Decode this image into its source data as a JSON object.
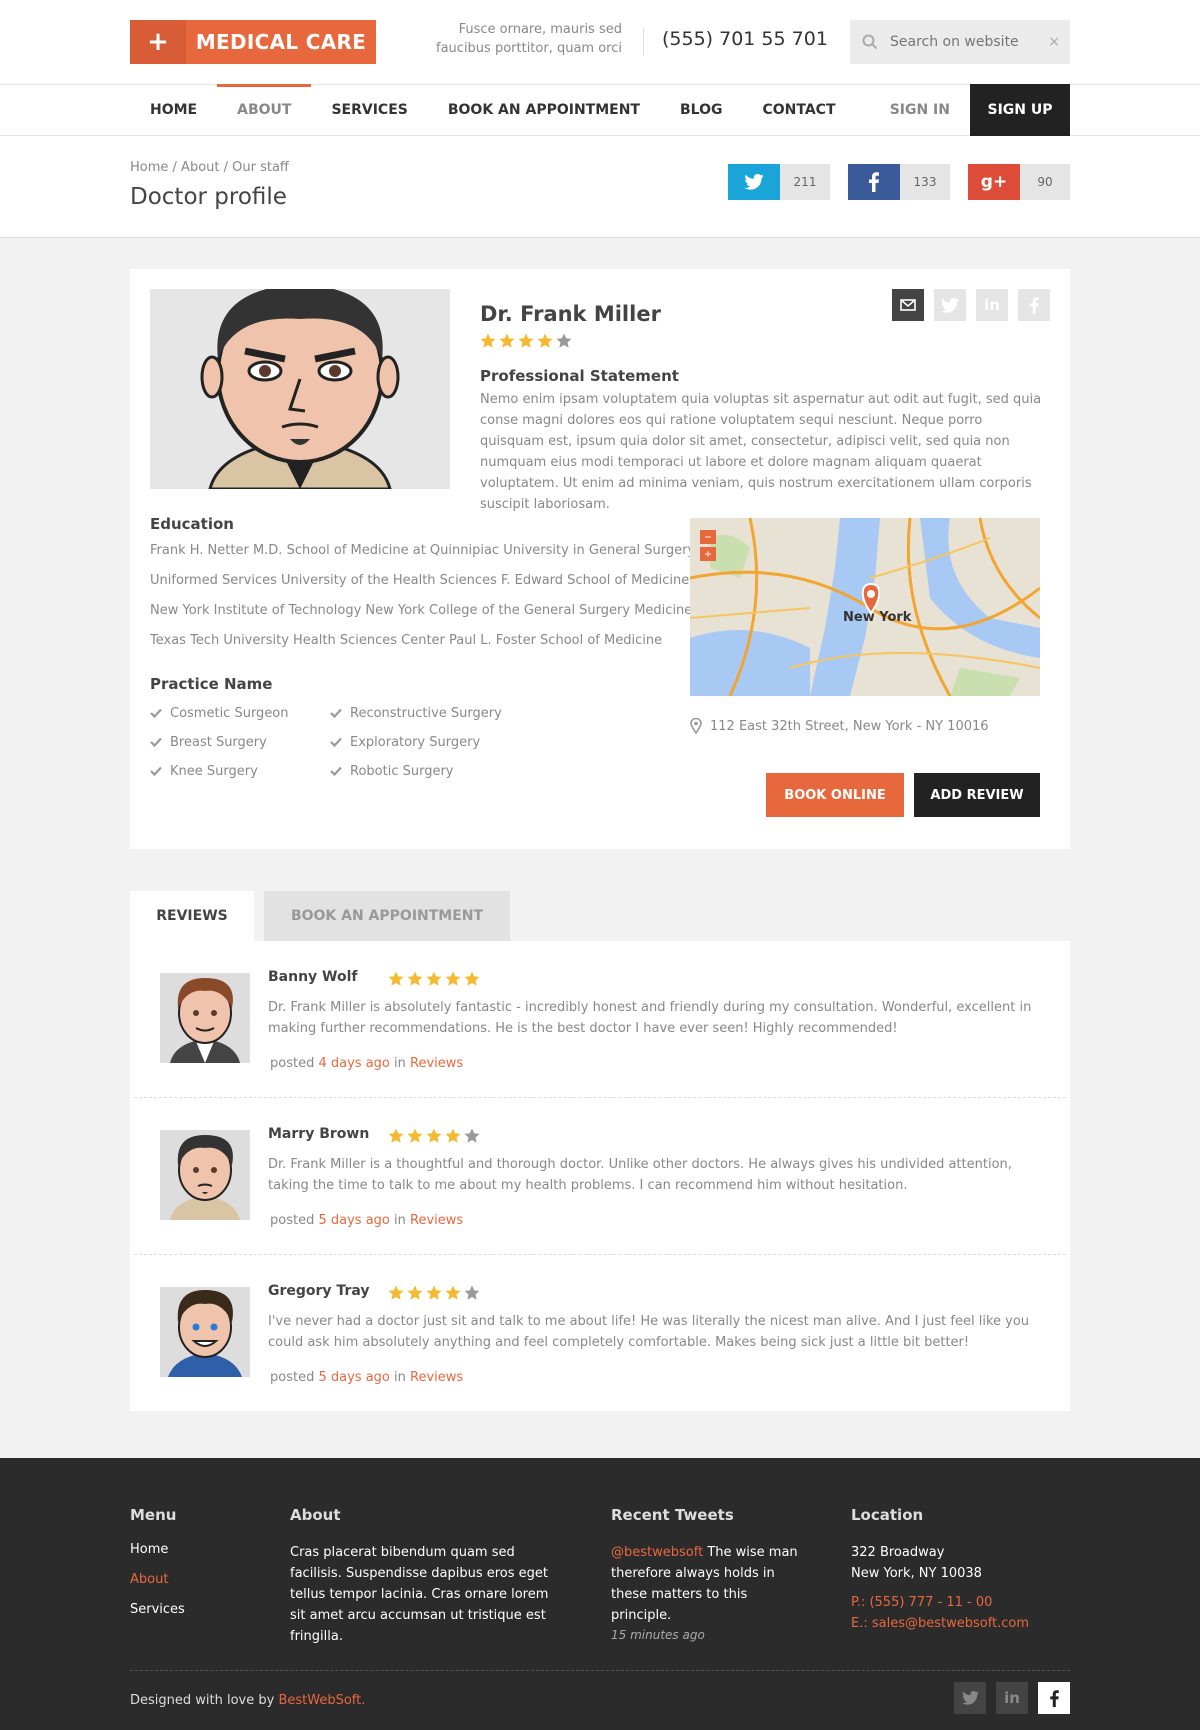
{
  "brand": {
    "plus": "+",
    "name": "MEDICAL CARE"
  },
  "header": {
    "tagline": "Fusce ornare, mauris sed faucibus porttitor, quam orci",
    "phone": "(555) 701 55 701",
    "search_placeholder": "Search on website",
    "search_clear": "×"
  },
  "nav": {
    "items": [
      "HOME",
      "ABOUT",
      "SERVICES",
      "BOOK AN APPOINTMENT",
      "BLOG",
      "CONTACT"
    ],
    "active": "ABOUT",
    "sign_in": "SIGN IN",
    "sign_up": "SIGN UP"
  },
  "page": {
    "breadcrumb": [
      "Home",
      "About",
      "Our staff"
    ],
    "title": "Doctor profile"
  },
  "shares": [
    {
      "network": "twitter",
      "color": "#1ba4d7",
      "count": "211"
    },
    {
      "network": "facebook",
      "color": "#3b5a9a",
      "count": "133"
    },
    {
      "network": "google-plus",
      "color": "#dd4b39",
      "count": "90"
    }
  ],
  "doctor": {
    "name": "Dr. Frank Miller",
    "rating": 4,
    "statement_heading": "Professional Statement",
    "statement": "Nemo enim ipsam voluptatem quia voluptas sit aspernatur aut odit aut fugit, sed quia conse magni dolores eos qui ratione voluptatem sequi nesciunt. Neque porro quisquam est, ipsum quia dolor sit amet, consectetur, adipisci velit, sed quia non numquam eius modi temporaci ut labore et dolore magnam aliquam quaerat voluptatem. Ut enim ad minima veniam, quis nostrum exercitationem ullam corporis suscipit laboriosam.",
    "education_heading": "Education",
    "education": [
      "Frank H. Netter M.D. School of Medicine at Quinnipiac University in General Surgery",
      "Uniformed Services University of the Health Sciences F. Edward School of Medicine",
      "New York Institute of Technology New York College of the General Surgery Medicine",
      "Texas Tech University Health Sciences Center Paul L. Foster School of Medicine"
    ],
    "practice_heading": "Practice Name",
    "practice": [
      "Cosmetic Surgeon",
      "Reconstructive Surgery",
      "Breast Surgery",
      "Exploratory Surgery",
      "Knee Surgery",
      "Robotic Surgery"
    ],
    "address": "112 East 32th Street, New York -  NY 10016",
    "map_label": "New York",
    "book_online": "BOOK ONLINE",
    "add_review": "ADD REVIEW"
  },
  "tabs": [
    "REVIEWS",
    "BOOK AN APPOINTMENT"
  ],
  "reviews": [
    {
      "name": "Banny Wolf",
      "rating": 5,
      "text": "Dr. Frank Miller is absolutely fantastic - incredibly honest and friendly during my consultation. Wonderful, excellent in making further recommendations.  He is the best doctor I have ever seen! Highly recommended!",
      "posted": "posted",
      "when": "4 days ago",
      "in": "in",
      "category": "Reviews"
    },
    {
      "name": "Marry Brown",
      "rating": 4,
      "text": "Dr. Frank Miller is a thoughtful and thorough doctor. Unlike other doctors. He always gives his undivided attention, taking the time to talk to me about my health problems. I can recommend him without hesitation.",
      "posted": "posted",
      "when": "5 days ago",
      "in": "in",
      "category": "Reviews"
    },
    {
      "name": "Gregory Tray",
      "rating": 4,
      "text": "I've never had a doctor just sit and talk to me about life! He was literally the nicest man alive. And I just feel like you could ask him absolutely anything and feel completely comfortable. Makes being sick just a little bit better!",
      "posted": "posted",
      "when": "5 days ago",
      "in": "in",
      "category": "Reviews"
    }
  ],
  "footer": {
    "menu_heading": "Menu",
    "menu": [
      "Home",
      "About",
      "Services"
    ],
    "about_heading": "About",
    "about_text": "Cras placerat bibendum quam sed facilisis. Suspendisse dapibus eros eget tellus tempor lacinia. Cras ornare lorem sit amet arcu accumsan ut tristique est fringilla.",
    "tweets_heading": "Recent Tweets",
    "tweet_handle": "@bestwebsoft",
    "tweet_text": " The wise man therefore always holds in these matters to this principle.",
    "tweet_time": "15 minutes ago",
    "location_heading": "Location",
    "street": "322 Broadway",
    "city": "New York, NY 10038",
    "phone": "P.: (555) 777 - 11 - 00",
    "email": "E.: sales@bestwebsoft.com",
    "copyright_prefix": "Designed with love by ",
    "copyright_link": "BestWebSoft."
  },
  "colors": {
    "accent": "#e8683e",
    "dark": "#222222",
    "star": "#f5b932",
    "star_off": "#999999"
  }
}
